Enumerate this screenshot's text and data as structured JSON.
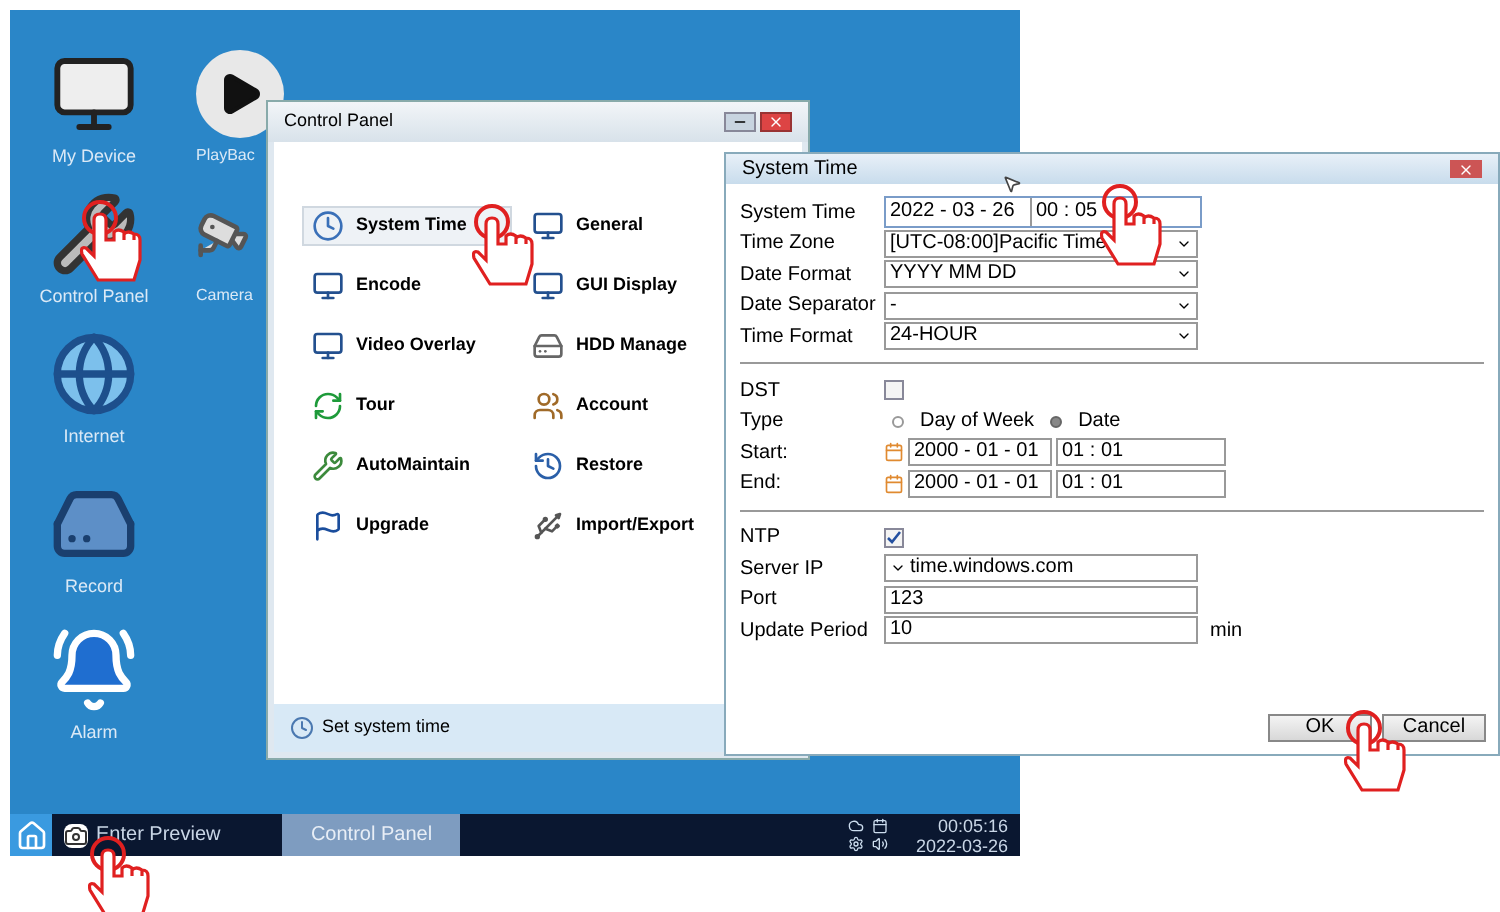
{
  "desktop_icons": [
    {
      "kind": "monitor",
      "label": "My Device"
    },
    {
      "kind": "play",
      "label": "PlayBac"
    },
    {
      "kind": "tools",
      "label": "Control Panel"
    },
    {
      "kind": "camera",
      "label": "Camera"
    },
    {
      "kind": "globe",
      "label": "Internet"
    },
    {
      "kind": "disk",
      "label": "Record"
    },
    {
      "kind": "alarm",
      "label": "Alarm"
    }
  ],
  "control_panel": {
    "title": "Control Panel",
    "items": [
      {
        "kind": "clock",
        "label": "System Time",
        "selected": true
      },
      {
        "kind": "monitor",
        "label": "General",
        "selected": false
      },
      {
        "kind": "monitor",
        "label": "Encode",
        "selected": false
      },
      {
        "kind": "monitor",
        "label": "GUI Display",
        "selected": false
      },
      {
        "kind": "monitor",
        "label": "Video Overlay",
        "selected": false
      },
      {
        "kind": "drive",
        "label": "HDD Manage",
        "selected": false
      },
      {
        "kind": "refresh",
        "label": "Tour",
        "selected": false
      },
      {
        "kind": "users",
        "label": "Account",
        "selected": false
      },
      {
        "kind": "wrench",
        "label": "AutoMaintain",
        "selected": false
      },
      {
        "kind": "restore",
        "label": "Restore",
        "selected": false
      },
      {
        "kind": "flag",
        "label": "Upgrade",
        "selected": false
      },
      {
        "kind": "usb",
        "label": "Import/Export",
        "selected": false
      }
    ],
    "status": "Set system time"
  },
  "dialog": {
    "title": "System Time",
    "rows": [
      {
        "kind": "datetime",
        "label": "System Time",
        "date": "2022 - 03 - 26",
        "time": "00 : 05"
      },
      {
        "kind": "select",
        "label": "Time Zone",
        "value": "[UTC-08:00]Pacific Time"
      },
      {
        "kind": "select",
        "label": "Date Format",
        "value": "YYYY MM DD"
      },
      {
        "kind": "select",
        "label": "Date Separator",
        "value": "-"
      },
      {
        "kind": "select",
        "label": "Time Format",
        "value": "24-HOUR"
      },
      {
        "kind": "divider"
      },
      {
        "kind": "checkbox",
        "label": "DST",
        "checked": false
      },
      {
        "kind": "radio",
        "label": "Type",
        "options": [
          {
            "label": "Day of Week",
            "selected": false
          },
          {
            "label": "Date",
            "selected": true
          }
        ]
      },
      {
        "kind": "range",
        "label": "Start:",
        "date": "2000 - 01 - 01",
        "time": "01 : 01"
      },
      {
        "kind": "range",
        "label": "End:",
        "date": "2000 - 01 - 01",
        "time": "01 : 01"
      },
      {
        "kind": "divider"
      },
      {
        "kind": "checkbox",
        "label": "NTP",
        "checked": true
      },
      {
        "kind": "combo",
        "label": "Server IP",
        "value": "time.windows.com"
      },
      {
        "kind": "text",
        "label": "Port",
        "value": "123"
      },
      {
        "kind": "text",
        "label": "Update Period",
        "value": "10",
        "unit": "min"
      }
    ],
    "buttons": [
      "OK",
      "Cancel"
    ]
  },
  "taskbar": {
    "preview": "Enter Preview",
    "tasks": [
      {
        "label": "Control Panel",
        "selected": true
      }
    ],
    "time": "00:05:16",
    "date": "2022-03-26"
  }
}
